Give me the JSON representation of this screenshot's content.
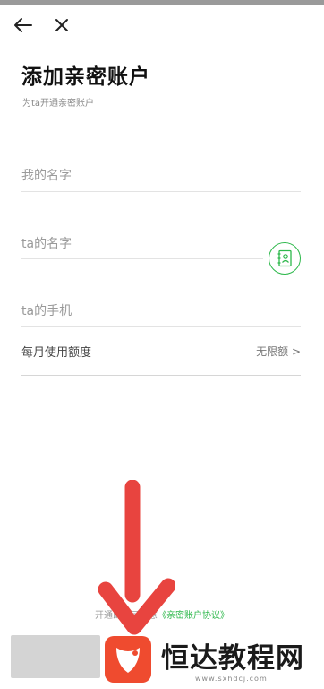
{
  "header": {
    "title": "添加亲密账户",
    "subtitle": "为ta开通亲密账户"
  },
  "form": {
    "my_name_placeholder": "我的名字",
    "ta_name_placeholder": "ta的名字",
    "ta_phone_placeholder": "ta的手机",
    "monthly_limit_label": "每月使用额度",
    "monthly_limit_value": "无限额 >"
  },
  "footer": {
    "agreement_prefix": "开通即表示同意",
    "agreement_link": "《亲密账户协议》"
  },
  "watermark": {
    "text": "恒达教程网",
    "url": "www.sxhdcj.com"
  },
  "colors": {
    "accent_green": "#2db84b",
    "annotation_red": "#e8443f"
  },
  "icons": {
    "back": "arrow-left-icon",
    "close": "close-icon",
    "contact": "contact-book-icon"
  }
}
